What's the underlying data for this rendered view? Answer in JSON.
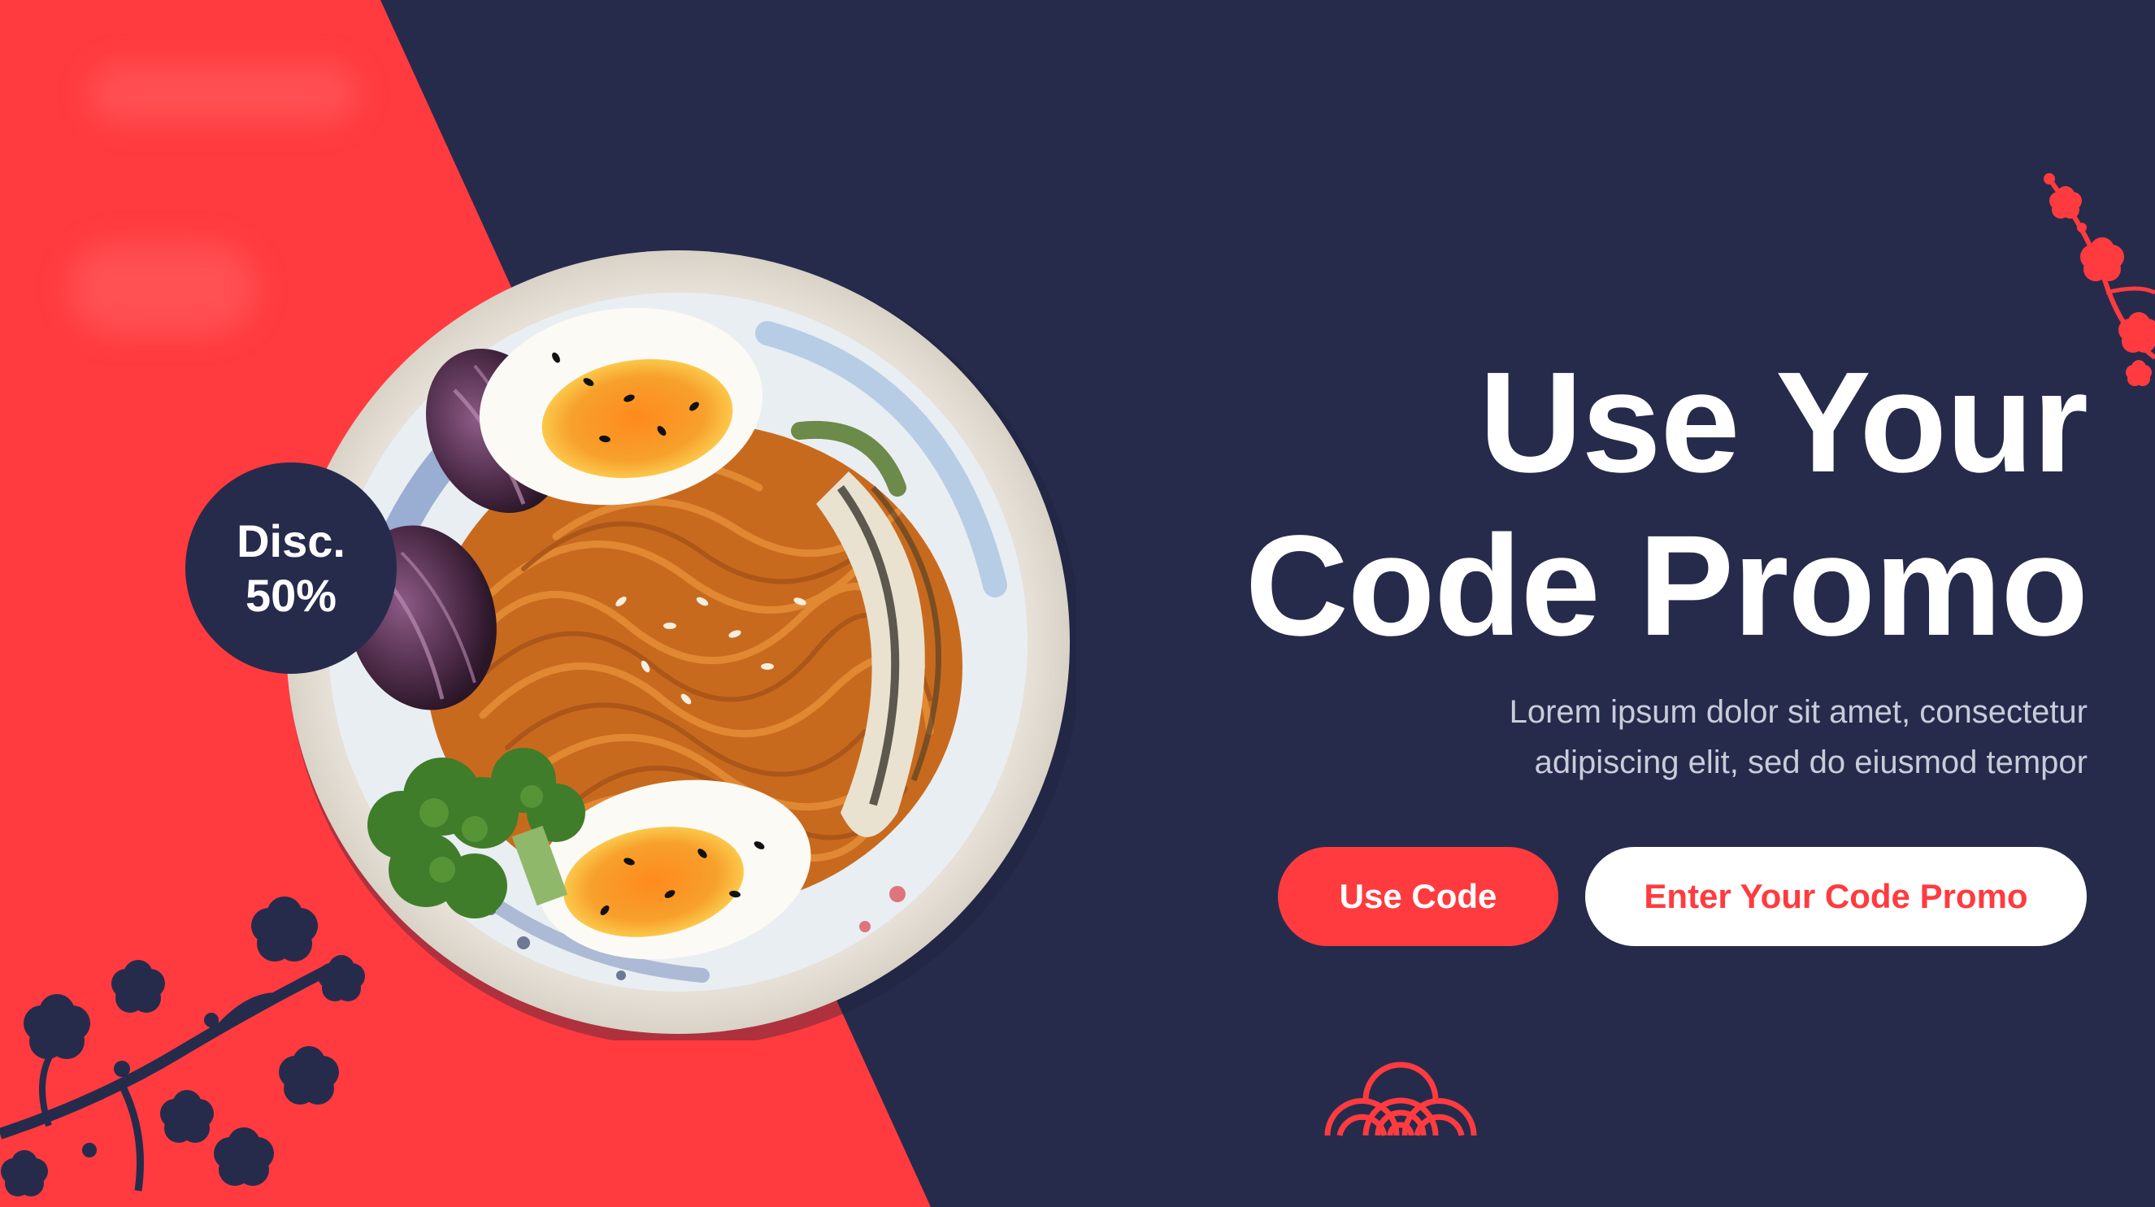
{
  "badge": {
    "line1": "Disc.",
    "line2": "50%"
  },
  "headline": {
    "line1": "Use Your",
    "line2": "Code Promo"
  },
  "subtext": {
    "line1": "Lorem ipsum dolor sit amet, consectetur",
    "line2": "adipiscing elit, sed do eiusmod tempor"
  },
  "buttons": {
    "use_code": "Use Code",
    "enter_code": "Enter Your Code Promo"
  },
  "colors": {
    "navy": "#262b4c",
    "red": "#ff3b3f",
    "white": "#ffffff"
  },
  "icons": {
    "bowl": "noodle-bowl-image",
    "blossom": "cherry-blossom-icon",
    "wave": "seigaiha-wave-icon"
  }
}
